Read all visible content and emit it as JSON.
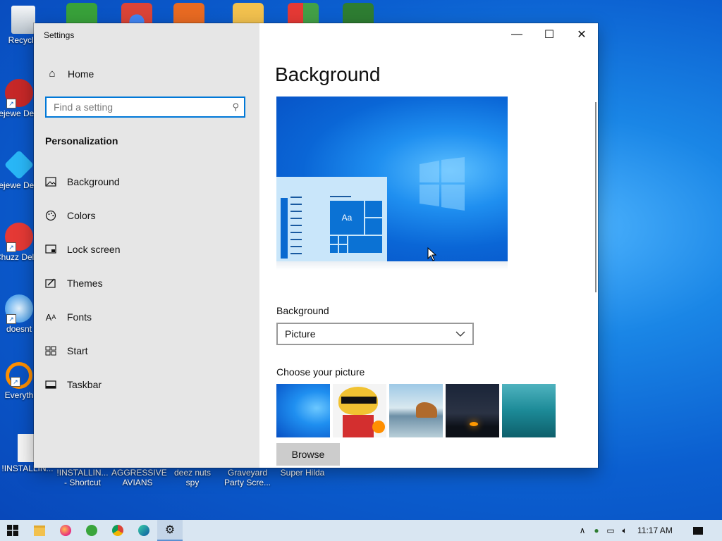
{
  "desktop": {
    "icons": [
      {
        "label": "Recycle"
      },
      {
        "label": "Bejewe Delux"
      },
      {
        "label": "Bejewe Delux"
      },
      {
        "label": "Chuzz Delux"
      },
      {
        "label": "doesnt"
      },
      {
        "label": "Everyth"
      }
    ],
    "bottom_icons": [
      {
        "label": "!INSTALLIN..."
      },
      {
        "label": "!INSTALLIN... - Shortcut"
      },
      {
        "label": "AGGRESSIVE AVIANS"
      },
      {
        "label": "deez nuts spy"
      },
      {
        "label": "Graveyard Party Scre..."
      },
      {
        "label": "Super Hilda"
      }
    ]
  },
  "window": {
    "title": "Settings",
    "controls": {
      "minimize": "—",
      "maximize": "☐",
      "close": "✕"
    }
  },
  "sidebar": {
    "home_label": "Home",
    "search_placeholder": "Find a setting",
    "section_title": "Personalization",
    "items": [
      {
        "label": "Background",
        "icon": "image-icon"
      },
      {
        "label": "Colors",
        "icon": "palette-icon"
      },
      {
        "label": "Lock screen",
        "icon": "lock-screen-icon"
      },
      {
        "label": "Themes",
        "icon": "themes-icon"
      },
      {
        "label": "Fonts",
        "icon": "fonts-icon"
      },
      {
        "label": "Start",
        "icon": "start-icon"
      },
      {
        "label": "Taskbar",
        "icon": "taskbar-icon"
      }
    ]
  },
  "main": {
    "title": "Background",
    "preview_tile_text": "Aa",
    "background_label": "Background",
    "background_value": "Picture",
    "choose_label": "Choose your picture",
    "browse_label": "Browse"
  },
  "taskbar": {
    "time": "11:17 AM",
    "colors": {
      "accent": "#0078d7",
      "bar": "#d9e6f2"
    }
  }
}
